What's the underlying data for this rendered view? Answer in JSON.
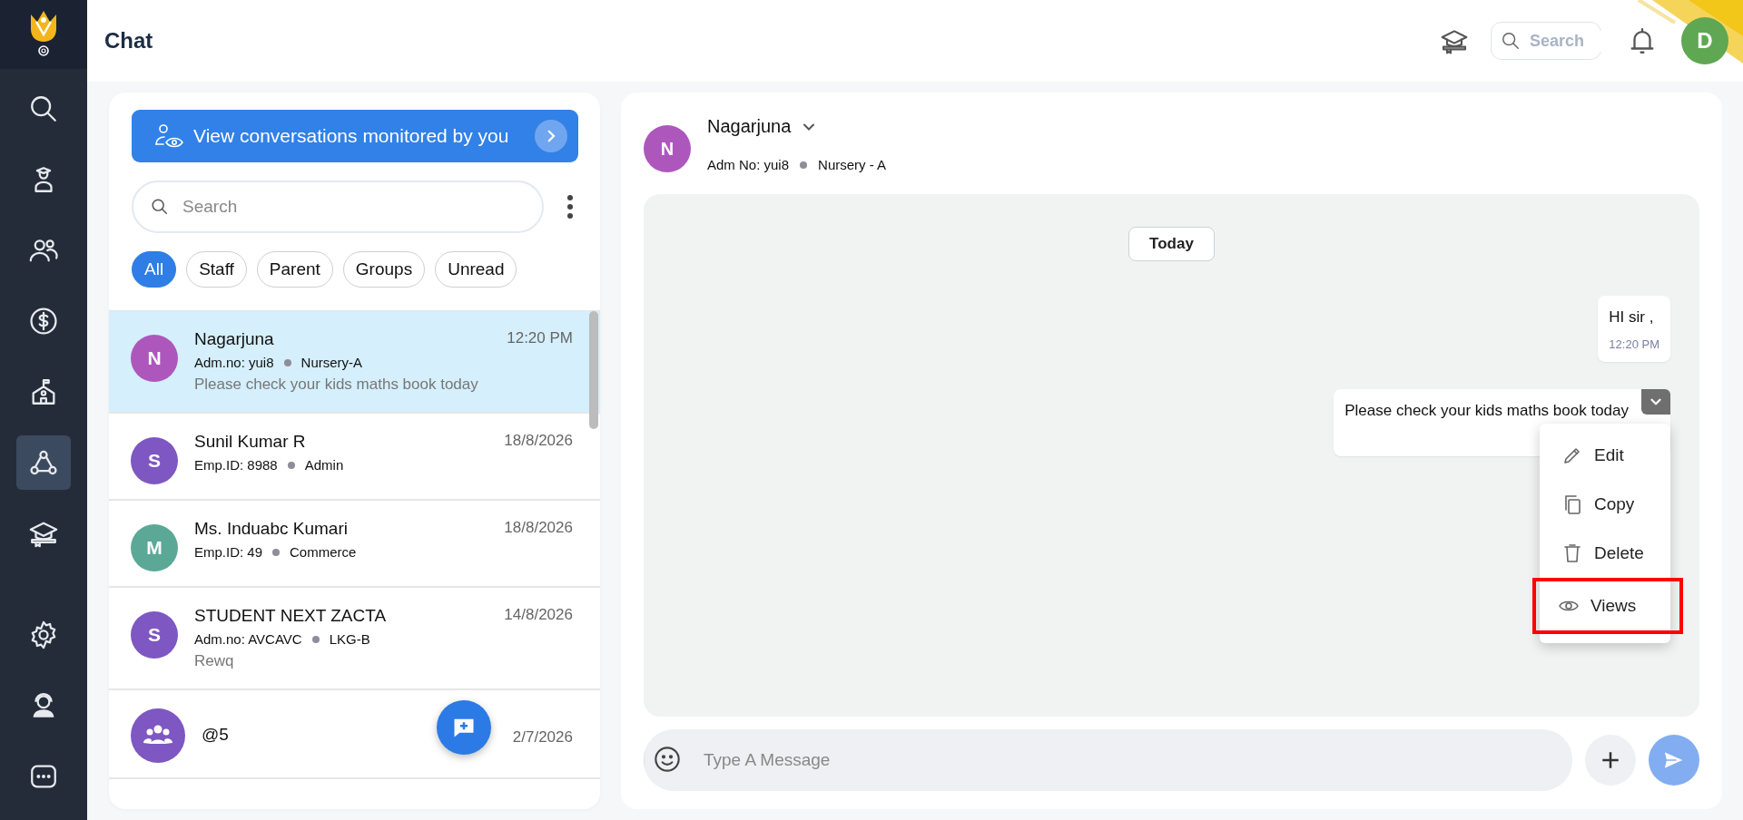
{
  "sidebar": {
    "items": [
      {
        "kind": "search",
        "selected": false
      },
      {
        "kind": "student",
        "selected": false
      },
      {
        "kind": "people",
        "selected": false
      },
      {
        "kind": "fees",
        "selected": false
      },
      {
        "kind": "school",
        "selected": false
      },
      {
        "kind": "chat",
        "selected": true
      },
      {
        "kind": "graduation",
        "selected": false
      },
      {
        "kind": "settings",
        "selected": false
      },
      {
        "kind": "support",
        "selected": false
      },
      {
        "kind": "more",
        "selected": false
      }
    ]
  },
  "header": {
    "title": "Chat",
    "search": {
      "placeholder": "Search"
    },
    "avatar": "D"
  },
  "conversations": {
    "monitor_banner": "View conversations monitored by you",
    "search": {
      "placeholder": "Search"
    },
    "filters": [
      {
        "label": "All",
        "selected": true
      },
      {
        "label": "Staff",
        "selected": false
      },
      {
        "label": "Parent",
        "selected": false
      },
      {
        "label": "Groups",
        "selected": false
      },
      {
        "label": "Unread",
        "selected": false
      }
    ],
    "items": [
      {
        "kind": "person",
        "initial": "N",
        "color": "#ad57bd",
        "name": "Nagarjuna",
        "id": "Adm.no: yui8",
        "group": "Nursery-A",
        "preview": "Please check your kids maths book today",
        "time": "12:20 PM",
        "selected": true
      },
      {
        "kind": "person",
        "initial": "S",
        "color": "#7e57c2",
        "name": "Sunil Kumar R",
        "id": "Emp.ID: 8988",
        "group": "Admin",
        "time": "18/8/2026",
        "selected": false
      },
      {
        "kind": "person",
        "initial": "M",
        "color": "#5ba896",
        "name": "Ms. Induabc Kumari",
        "id": "Emp.ID: 49",
        "group": "Commerce",
        "time": "18/8/2026",
        "selected": false
      },
      {
        "kind": "person",
        "initial": "S",
        "color": "#7e57c2",
        "name": "STUDENT NEXT ZACTA",
        "id": "Adm.no: AVCAVC",
        "group": "LKG-B",
        "preview": "Rewq",
        "time": "14/8/2026",
        "selected": false
      },
      {
        "kind": "group",
        "color": "#7e57c2",
        "name": "@5",
        "time": "2/7/2026",
        "selected": false
      }
    ]
  },
  "chat": {
    "contact": {
      "initial": "N",
      "color": "#ad57bd",
      "name": "Nagarjuna",
      "id": "Adm No: yui8",
      "group": "Nursery - A"
    },
    "date_label": "Today",
    "messages": [
      {
        "text": "HI sir ,",
        "time": "12:20 PM",
        "menu_open": false
      },
      {
        "text": "Please check your kids maths book today",
        "menu_open": true
      }
    ],
    "menu": [
      {
        "kind": "edit",
        "label": "Edit",
        "highlighted": false
      },
      {
        "kind": "copy",
        "label": "Copy",
        "highlighted": false
      },
      {
        "kind": "delete",
        "label": "Delete",
        "highlighted": false
      },
      {
        "kind": "views",
        "label": "Views",
        "highlighted": true
      }
    ],
    "composer": {
      "placeholder": "Type A Message"
    }
  }
}
